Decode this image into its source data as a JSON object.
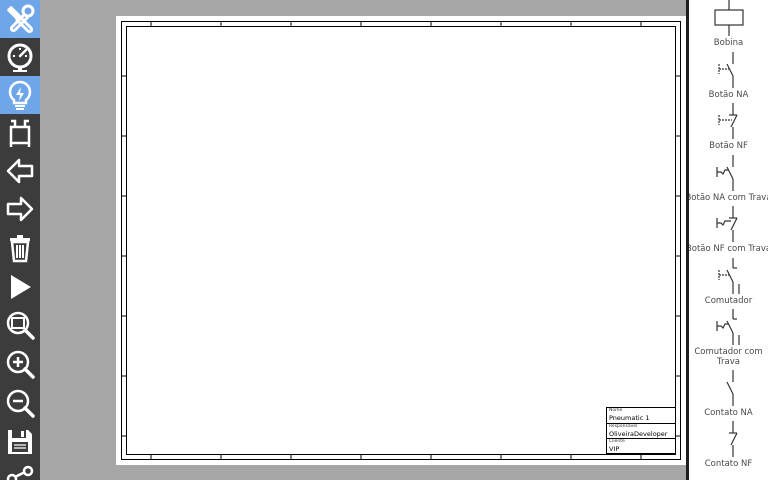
{
  "toolbar": {
    "tools": [
      {
        "name": "tools-icon",
        "active": true
      },
      {
        "name": "gauge-icon",
        "active": false
      },
      {
        "name": "lightbulb-icon",
        "active": true
      },
      {
        "name": "connector-icon",
        "active": false
      },
      {
        "name": "arrow-left-icon",
        "active": false
      },
      {
        "name": "arrow-right-icon",
        "active": false
      },
      {
        "name": "trash-icon",
        "active": false
      },
      {
        "name": "play-icon",
        "active": false
      },
      {
        "name": "zoom-fit-icon",
        "active": false
      },
      {
        "name": "zoom-in-icon",
        "active": false
      },
      {
        "name": "zoom-out-icon",
        "active": false
      },
      {
        "name": "save-icon",
        "active": false
      },
      {
        "name": "share-icon",
        "active": false
      }
    ],
    "colors": {
      "background": "#3c3c3c",
      "active": "#6fa6e8",
      "icon": "#ffffff"
    }
  },
  "title_block": {
    "name_label": "Nome",
    "name_value": "Pneumatic 1",
    "responsible_label": "Responsável",
    "responsible_value": "OliveiraDeveloper",
    "client_label": "Cliente",
    "client_value": "VIP"
  },
  "palette": {
    "items": [
      {
        "label": "Bobina",
        "icon": "coil-icon"
      },
      {
        "label": "Botão NA",
        "icon": "pushbutton-no-icon"
      },
      {
        "label": "Botão NF",
        "icon": "pushbutton-nc-icon"
      },
      {
        "label": "Botão NA com Trava",
        "icon": "pushbutton-no-latch-icon"
      },
      {
        "label": "Botão NF com Trava",
        "icon": "pushbutton-nc-latch-icon"
      },
      {
        "label": "Comutador",
        "icon": "changeover-icon"
      },
      {
        "label": "Comutador com",
        "label2": "Trava",
        "icon": "changeover-latch-icon"
      },
      {
        "label": "Contato NA",
        "icon": "contact-no-icon"
      },
      {
        "label": "Contato NF",
        "icon": "contact-nc-icon"
      }
    ]
  }
}
